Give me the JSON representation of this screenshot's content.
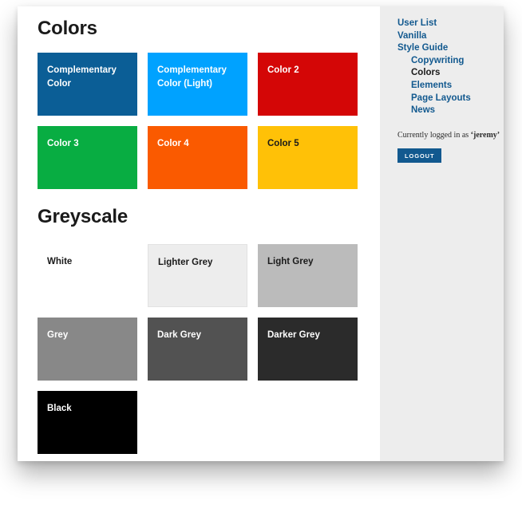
{
  "main": {
    "colors_heading": "Colors",
    "greyscale_heading": "Greyscale",
    "color_swatches": [
      {
        "label": "Complementary Color",
        "bg": "#0b5e96",
        "fg": "#ffffff",
        "bordered": false
      },
      {
        "label": "Complementary Color (Light)",
        "bg": "#00a2ff",
        "fg": "#ffffff",
        "bordered": false
      },
      {
        "label": "Color 2",
        "bg": "#d40606",
        "fg": "#ffffff",
        "bordered": false
      },
      {
        "label": "Color 3",
        "bg": "#08ad42",
        "fg": "#ffffff",
        "bordered": false
      },
      {
        "label": "Color 4",
        "bg": "#fa5a00",
        "fg": "#ffffff",
        "bordered": false
      },
      {
        "label": "Color 5",
        "bg": "#ffc107",
        "fg": "#1a1a1a",
        "bordered": false
      }
    ],
    "grey_swatches": [
      {
        "label": "White",
        "bg": "#ffffff",
        "fg": "#1a1a1a",
        "bordered": false
      },
      {
        "label": "Lighter Grey",
        "bg": "#ededed",
        "fg": "#1a1a1a",
        "bordered": true
      },
      {
        "label": "Light Grey",
        "bg": "#bbbbbb",
        "fg": "#1a1a1a",
        "bordered": false
      },
      {
        "label": "Grey",
        "bg": "#888888",
        "fg": "#ffffff",
        "bordered": false
      },
      {
        "label": "Dark Grey",
        "bg": "#525252",
        "fg": "#ffffff",
        "bordered": false
      },
      {
        "label": "Darker Grey",
        "bg": "#2b2b2b",
        "fg": "#ffffff",
        "bordered": false
      },
      {
        "label": "Black",
        "bg": "#000000",
        "fg": "#ffffff",
        "bordered": false
      }
    ]
  },
  "sidebar": {
    "nav": [
      {
        "label": "User List",
        "sub": false,
        "active": false
      },
      {
        "label": "Vanilla",
        "sub": false,
        "active": false
      },
      {
        "label": "Style Guide",
        "sub": false,
        "active": false
      },
      {
        "label": "Copywriting",
        "sub": true,
        "active": false
      },
      {
        "label": "Colors",
        "sub": true,
        "active": true
      },
      {
        "label": "Elements",
        "sub": true,
        "active": false
      },
      {
        "label": "Page Layouts",
        "sub": true,
        "active": false
      },
      {
        "label": "News",
        "sub": true,
        "active": false
      }
    ],
    "login_prefix": "Currently logged in as ",
    "login_username": "‘jeremy’",
    "logout_label": "LOGOUT"
  }
}
